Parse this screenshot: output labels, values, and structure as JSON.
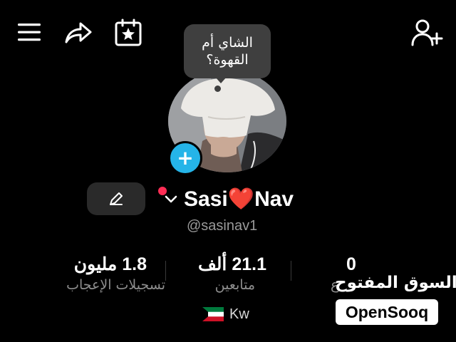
{
  "topbar": {
    "icons": [
      "menu-icon",
      "share-icon",
      "calendar-star-icon",
      "add-user-icon"
    ]
  },
  "bubble": {
    "line1": "الشاي أم",
    "line2": "القهوة؟"
  },
  "profile": {
    "name_left": "Sasi",
    "heart": "❤️",
    "name_right": "Nav",
    "username": "@sasinav1",
    "add_badge": "+"
  },
  "stats": {
    "likes": {
      "value": "1.8 مليون",
      "label": "تسجيلات الإعجاب"
    },
    "followers": {
      "value": "21.1 ألف",
      "label": "متابعين"
    },
    "following": {
      "value": "0",
      "label": "ع"
    }
  },
  "country": {
    "flag": "🇰🇼",
    "code": "Kw"
  },
  "watermark": {
    "arabic": "السوق المفتوح",
    "latin": "OpenSooq"
  },
  "colors": {
    "accent": "#25b4e8",
    "notify": "#ff2d55",
    "background": "#000000"
  }
}
